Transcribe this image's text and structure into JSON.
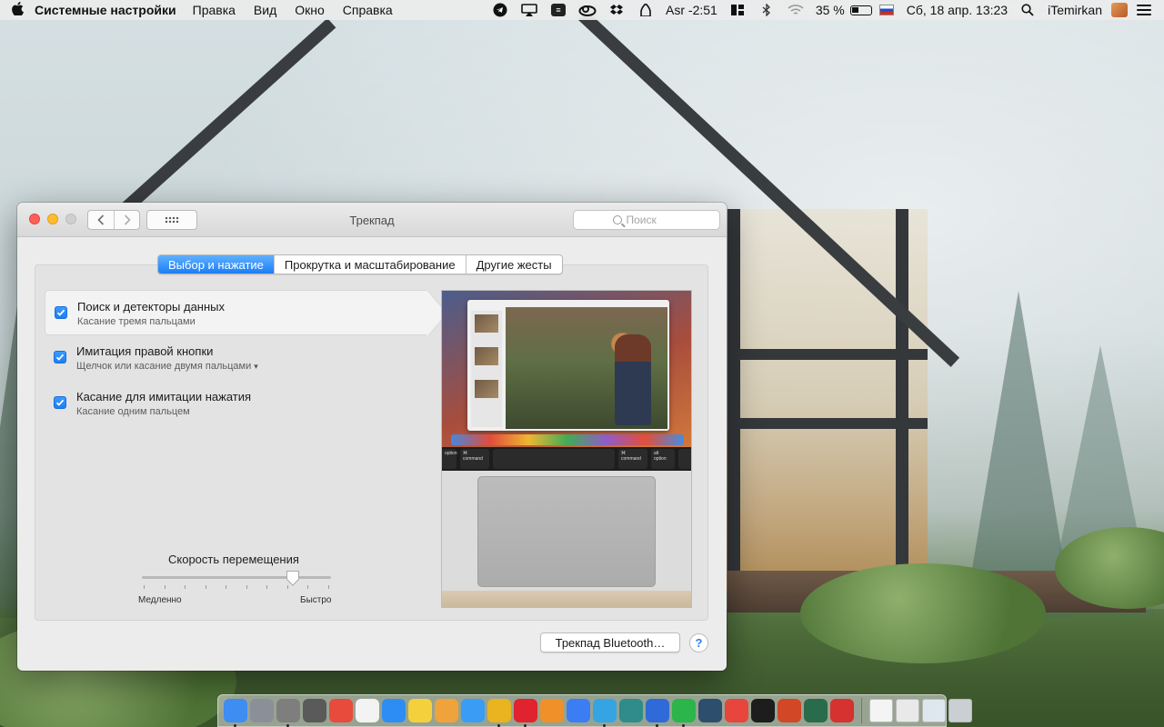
{
  "menubar": {
    "apple_icon": "apple-logo",
    "app_name": "Системные настройки",
    "menus": [
      "Правка",
      "Вид",
      "Окно",
      "Справка"
    ],
    "prayer_time": "Asr -2:51",
    "battery_percent": "35 %",
    "datetime": "Сб, 18 апр.  13:23",
    "user": "iTemirkan",
    "status_icons": [
      "telegram-icon",
      "airplay-icon",
      "notes-icon",
      "creative-cloud-icon",
      "dropbox-icon",
      "prayer-icon",
      "columns-icon",
      "bluetooth-icon",
      "wifi-icon",
      "battery-icon",
      "flag-ru-icon",
      "spotlight-icon",
      "user-avatar",
      "notification-center-icon"
    ]
  },
  "window": {
    "title": "Трекпад",
    "search_placeholder": "Поиск",
    "tabs": [
      {
        "label": "Выбор и нажатие",
        "active": true
      },
      {
        "label": "Прокрутка и масштабирование",
        "active": false
      },
      {
        "label": "Другие жесты",
        "active": false
      }
    ],
    "options": [
      {
        "title": "Поиск и детекторы данных",
        "subtitle": "Касание тремя пальцами",
        "checked": true,
        "selected": true,
        "has_dropdown": false
      },
      {
        "title": "Имитация правой кнопки",
        "subtitle": "Щелчок или касание двумя пальцами",
        "checked": true,
        "selected": false,
        "has_dropdown": true
      },
      {
        "title": "Касание для имитации нажатия",
        "subtitle": "Касание одним пальцем",
        "checked": true,
        "selected": false,
        "has_dropdown": false
      }
    ],
    "tracking_speed": {
      "label": "Скорость перемещения",
      "min_label": "Медленно",
      "max_label": "Быстро",
      "value_fraction": 0.8,
      "ticks": 10
    },
    "preview_keys": {
      "left_alt": "option",
      "left_cmd": "command",
      "right_cmd": "command",
      "right_alt": "option",
      "cmd_symbol": "⌘",
      "alt_symbol": "alt"
    },
    "bluetooth_button": "Трекпад Bluetooth…",
    "help_button": "?",
    "colors": {
      "accent": "#1b7ef4",
      "close": "#ff5f57",
      "minimize": "#febc2e"
    }
  },
  "dock": {
    "items": [
      {
        "name": "finder-icon",
        "color": "#3d8df2",
        "running": true
      },
      {
        "name": "launchpad-icon",
        "color": "#8a8f98",
        "running": false
      },
      {
        "name": "system-preferences-icon",
        "color": "#7e7e7e",
        "running": true
      },
      {
        "name": "calculator-icon",
        "color": "#5a5a5a",
        "running": false
      },
      {
        "name": "reminders-icon",
        "color": "#e84a3c",
        "running": false
      },
      {
        "name": "calendar-icon",
        "color": "#f3f3f3",
        "running": false
      },
      {
        "name": "app-store-icon",
        "color": "#2d8df5",
        "running": false
      },
      {
        "name": "notes-icon",
        "color": "#f4d13c",
        "running": false
      },
      {
        "name": "photos-icon",
        "color": "#f0a23b",
        "running": false
      },
      {
        "name": "safari-icon",
        "color": "#3a9cf5",
        "running": false
      },
      {
        "name": "chrome-icon",
        "color": "#e9b420",
        "running": true
      },
      {
        "name": "opera-icon",
        "color": "#e0232f",
        "running": true
      },
      {
        "name": "books-icon",
        "color": "#f09029",
        "running": false
      },
      {
        "name": "testflight-icon",
        "color": "#3b7ef3",
        "running": false
      },
      {
        "name": "telegram-icon",
        "color": "#35a4e3",
        "running": true
      },
      {
        "name": "pyrus-icon",
        "color": "#2f8c8a",
        "running": false
      },
      {
        "name": "tasks-icon",
        "color": "#2f6ad8",
        "running": true
      },
      {
        "name": "whatsapp-icon",
        "color": "#2bb54a",
        "running": true
      },
      {
        "name": "nox-icon",
        "color": "#2d4e6c",
        "running": false
      },
      {
        "name": "grammarly-icon",
        "color": "#e8453c",
        "running": false
      },
      {
        "name": "hand-mirror-icon",
        "color": "#1d1d1d",
        "running": false
      },
      {
        "name": "powerpoint-icon",
        "color": "#d24726",
        "running": false
      },
      {
        "name": "feather-icon",
        "color": "#2a6b4c",
        "running": false
      },
      {
        "name": "sketchup-icon",
        "color": "#d6322f",
        "running": false
      }
    ],
    "docs": [
      {
        "name": "document-stack-icon",
        "color": "#f4f4f4"
      },
      {
        "name": "slides-stack-icon",
        "color": "#e9e9e9"
      },
      {
        "name": "file-stack-icon",
        "color": "#dfe7ee"
      },
      {
        "name": "trash-icon",
        "color": "#c9cfd3"
      }
    ]
  }
}
